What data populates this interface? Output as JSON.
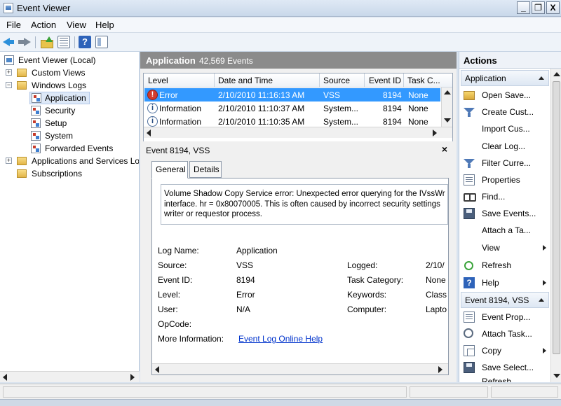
{
  "window": {
    "title": "Event Viewer",
    "buttons": {
      "minimize": "_",
      "maximize": "❐",
      "close": "X"
    }
  },
  "menu": [
    "File",
    "Action",
    "View",
    "Help"
  ],
  "tree": {
    "items": [
      {
        "label": "Event Viewer (Local)",
        "icon": "event-viewer-icon"
      },
      {
        "label": "Custom Views",
        "icon": "folder-icon"
      },
      {
        "label": "Windows Logs",
        "icon": "folder-icon"
      },
      {
        "label": "Application",
        "icon": "log-icon",
        "selected": true
      },
      {
        "label": "Security",
        "icon": "log-icon"
      },
      {
        "label": "Setup",
        "icon": "log-icon"
      },
      {
        "label": "System",
        "icon": "log-icon"
      },
      {
        "label": "Forwarded Events",
        "icon": "log-icon"
      },
      {
        "label": "Applications and Services Lo",
        "icon": "folder-icon"
      },
      {
        "label": "Subscriptions",
        "icon": "folder-icon"
      }
    ]
  },
  "center": {
    "title": "Application",
    "count": "42,569 Events",
    "columns": [
      "Level",
      "Date and Time",
      "Source",
      "Event ID",
      "Task C..."
    ],
    "rows": [
      {
        "level": "Error",
        "datetime": "2/10/2010 11:16:13 AM",
        "source": "VSS",
        "event_id": "8194",
        "task": "None"
      },
      {
        "level": "Information",
        "datetime": "2/10/2010 11:10:37 AM",
        "source": "System...",
        "event_id": "8194",
        "task": "None"
      },
      {
        "level": "Information",
        "datetime": "2/10/2010 11:10:35 AM",
        "source": "System...",
        "event_id": "8194",
        "task": "None"
      }
    ]
  },
  "detail": {
    "title": "Event 8194, VSS",
    "close": "×",
    "tabs": [
      "General",
      "Details"
    ],
    "message": [
      "Volume Shadow Copy Service error: Unexpected error querying for the IVssWr",
      "interface.  hr = 0x80070005. This is often caused by incorrect security settings",
      "writer or requestor process."
    ],
    "fields": {
      "log_name_label": "Log Name:",
      "log_name": "Application",
      "source_label": "Source:",
      "source": "VSS",
      "logged_label": "Logged:",
      "logged": "2/10/",
      "event_id_label": "Event ID:",
      "event_id": "8194",
      "task_category_label": "Task Category:",
      "task_category": "None",
      "level_label": "Level:",
      "level": "Error",
      "keywords_label": "Keywords:",
      "keywords": "Class",
      "user_label": "User:",
      "user": "N/A",
      "computer_label": "Computer:",
      "computer": "Lapto",
      "opcode_label": "OpCode:",
      "opcode": "",
      "more_info_label": "More Information:",
      "more_info_link": "Event Log Online Help"
    }
  },
  "actions": {
    "title": "Actions",
    "sections": [
      {
        "title": "Application",
        "items": [
          {
            "label": "Open Save...",
            "icon": "open-folder-icon"
          },
          {
            "label": "Create Cust...",
            "icon": "filter-icon"
          },
          {
            "label": "Import Cus...",
            "icon": "none"
          },
          {
            "label": "Clear Log...",
            "icon": "none"
          },
          {
            "label": "Filter Curre...",
            "icon": "filter-icon"
          },
          {
            "label": "Properties",
            "icon": "properties-icon"
          },
          {
            "label": "Find...",
            "icon": "binoculars-icon"
          },
          {
            "label": "Save Events...",
            "icon": "save-icon"
          },
          {
            "label": "Attach a Ta...",
            "icon": "none"
          },
          {
            "label": "View",
            "icon": "none",
            "submenu": true
          },
          {
            "label": "Refresh",
            "icon": "refresh-icon"
          },
          {
            "label": "Help",
            "icon": "help-icon",
            "submenu": true
          }
        ]
      },
      {
        "title": "Event 8194, VSS",
        "items": [
          {
            "label": "Event Prop...",
            "icon": "event-properties-icon"
          },
          {
            "label": "Attach Task...",
            "icon": "attach-task-icon"
          },
          {
            "label": "Copy",
            "icon": "copy-icon",
            "submenu": true
          },
          {
            "label": "Save Select...",
            "icon": "save-icon"
          },
          {
            "label": "Refresh",
            "icon": "refresh-icon"
          }
        ]
      }
    ]
  },
  "colors": {
    "selection": "#3399ff",
    "header_gray": "#8b8b8b",
    "link": "#0033cc"
  }
}
